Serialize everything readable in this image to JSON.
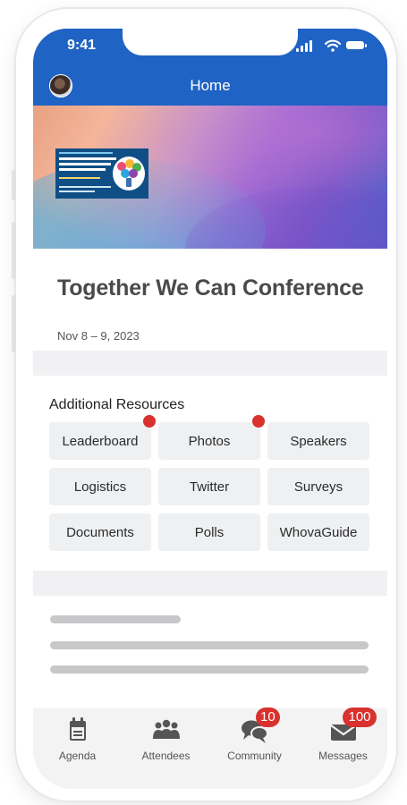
{
  "status_bar": {
    "time": "9:41"
  },
  "header": {
    "title": "Home"
  },
  "event": {
    "name": "Together We Can Conference",
    "dates": "Nov 8 – 9, 2023"
  },
  "resources": {
    "title": "Additional Resources",
    "buttons": [
      {
        "label": "Leaderboard",
        "has_dot": true
      },
      {
        "label": "Photos",
        "has_dot": true
      },
      {
        "label": "Speakers",
        "has_dot": false
      },
      {
        "label": "Logistics",
        "has_dot": false
      },
      {
        "label": "Twitter",
        "has_dot": false
      },
      {
        "label": "Surveys",
        "has_dot": false
      },
      {
        "label": "Documents",
        "has_dot": false
      },
      {
        "label": "Polls",
        "has_dot": false
      },
      {
        "label": "WhovaGuide",
        "has_dot": false
      }
    ]
  },
  "tabbar": {
    "tabs": [
      {
        "label": "Agenda",
        "icon": "calendar-icon"
      },
      {
        "label": "Attendees",
        "icon": "people-icon"
      },
      {
        "label": "Community",
        "icon": "chat-bubbles-icon",
        "badge": "10"
      },
      {
        "label": "Messages",
        "icon": "envelope-icon",
        "badge": "100"
      }
    ]
  },
  "colors": {
    "header_blue": "#1f63c4",
    "badge_red": "#d8312e",
    "button_bg": "#eef0f2"
  }
}
